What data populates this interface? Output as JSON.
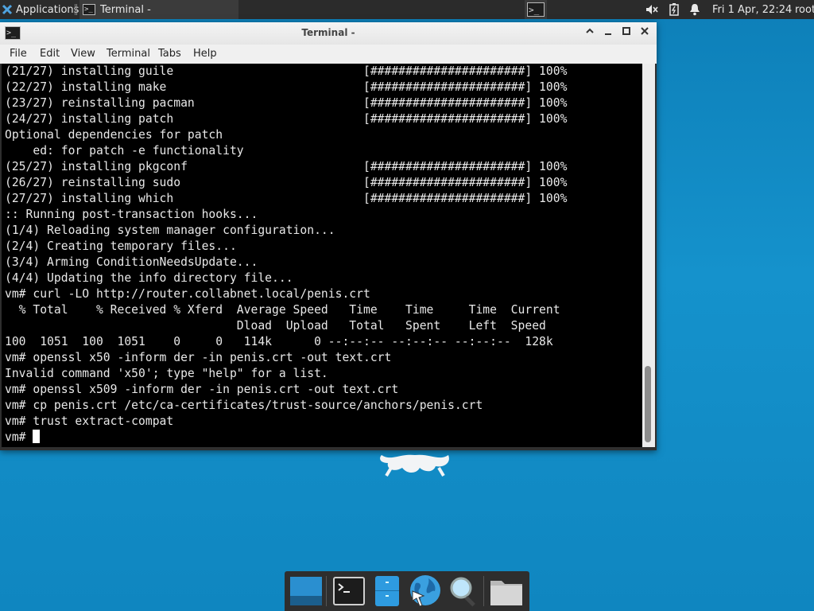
{
  "top_panel": {
    "apps_label": "Applications",
    "task_label": "Terminal -",
    "clock": "Fri  1 Apr, 22:24",
    "user": "root",
    "icons": [
      "apps-icon",
      "terminal-icon",
      "volume-muted-icon",
      "battery-icon",
      "notification-bell-icon"
    ]
  },
  "window": {
    "title": "Terminal -",
    "menu": [
      "File",
      "Edit",
      "View",
      "Terminal",
      "Tabs",
      "Help"
    ],
    "controls": [
      "shade-icon",
      "minimize-icon",
      "maximize-icon",
      "close-icon"
    ]
  },
  "terminal": {
    "lines": [
      "(21/27) installing guile                           [######################] 100%",
      "(22/27) installing make                            [######################] 100%",
      "(23/27) reinstalling pacman                        [######################] 100%",
      "(24/27) installing patch                           [######################] 100%",
      "Optional dependencies for patch",
      "    ed: for patch -e functionality",
      "(25/27) installing pkgconf                         [######################] 100%",
      "(26/27) reinstalling sudo                          [######################] 100%",
      "(27/27) installing which                           [######################] 100%",
      ":: Running post-transaction hooks...",
      "(1/4) Reloading system manager configuration...",
      "(2/4) Creating temporary files...",
      "(3/4) Arming ConditionNeedsUpdate...",
      "(4/4) Updating the info directory file...",
      "vm# curl -LO http://router.collabnet.local/penis.crt",
      "  % Total    % Received % Xferd  Average Speed   Time    Time     Time  Current",
      "                                 Dload  Upload   Total   Spent    Left  Speed",
      "100  1051  100  1051    0     0   114k      0 --:--:-- --:--:-- --:--:--  128k",
      "vm# openssl x50 -inform der -in penis.crt -out text.crt",
      "Invalid command 'x50'; type \"help\" for a list.",
      "vm# openssl x509 -inform der -in penis.crt -out text.crt",
      "vm# cp penis.crt /etc/ca-certificates/trust-source/anchors/penis.crt",
      "vm# trust extract-compat"
    ],
    "prompt": "vm# "
  },
  "dock": {
    "items": [
      "desktop-icon",
      "terminal-icon",
      "files-icon",
      "web-browser-icon",
      "search-icon",
      "folder-icon"
    ]
  }
}
